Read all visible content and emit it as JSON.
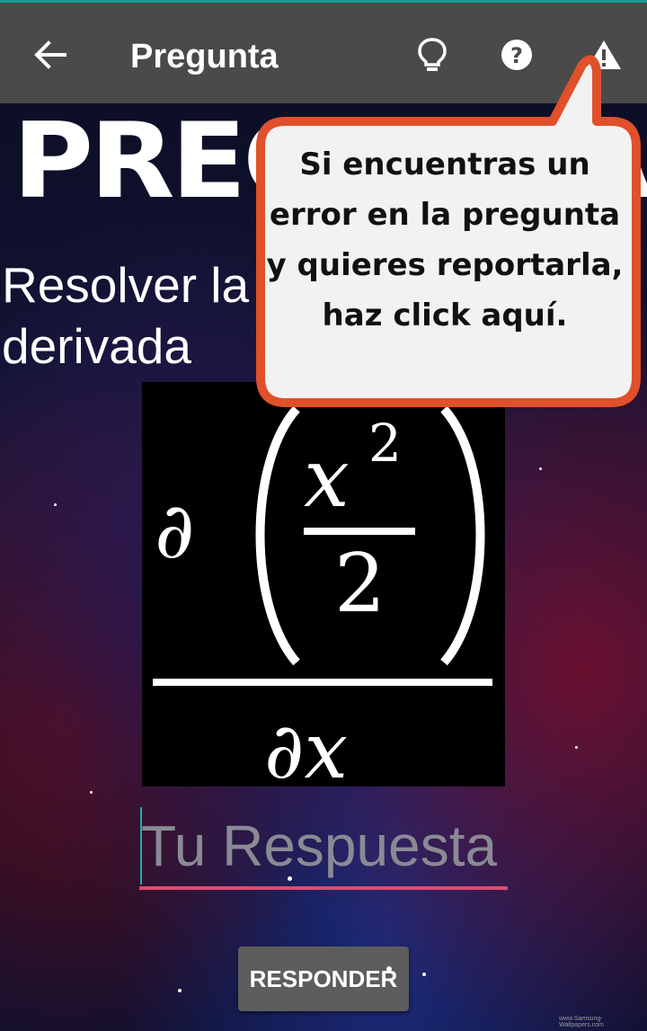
{
  "appbar": {
    "title": "Pregunta",
    "icons": [
      "back-arrow-icon",
      "lightbulb-icon",
      "help-icon",
      "warning-icon"
    ]
  },
  "banner": {
    "text": "PREGUNTA"
  },
  "question": {
    "text": "Resolver la siguiente derivada"
  },
  "formula": {
    "numerator_base": "x",
    "numerator_exponent": "2",
    "denominator": "2",
    "partial": "∂",
    "wrt": "∂x"
  },
  "answer": {
    "placeholder": "Tu Respuesta",
    "value": ""
  },
  "submit": {
    "label": "RESPONDER"
  },
  "tooltip": {
    "text": "Si encuentras un error en la pregunta y quieres reportarla, haz click aquí."
  },
  "watermark": {
    "text": "www.Samsung-Wallpapers.com"
  },
  "colors": {
    "appbar": "#4a4a4a",
    "accent_underline": "#e04a72",
    "tooltip_border": "#e0502a",
    "topline": "#139a8f"
  }
}
